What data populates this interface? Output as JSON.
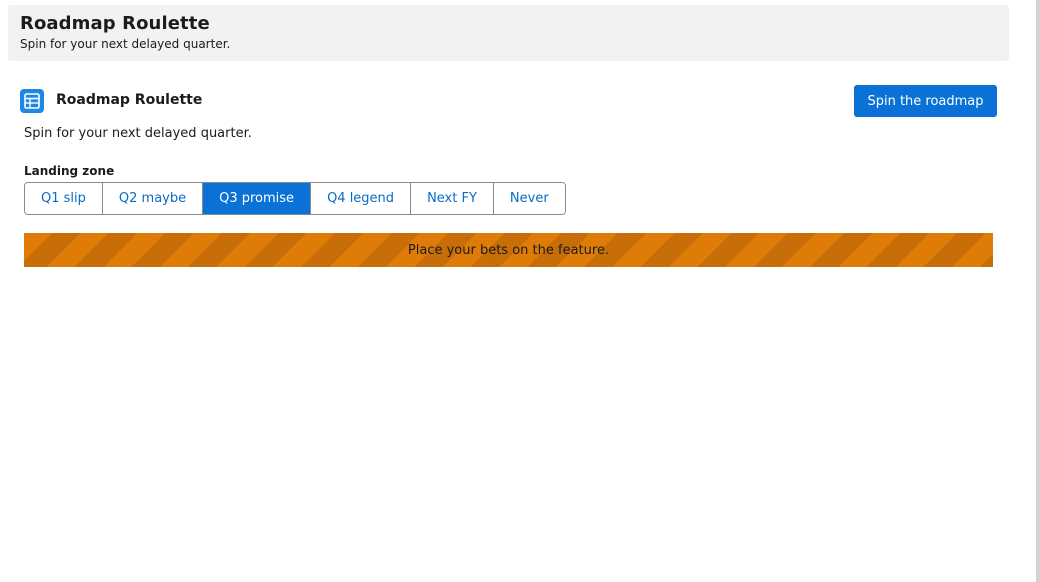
{
  "header": {
    "title": "Roadmap Roulette",
    "subtitle": "Spin for your next delayed quarter."
  },
  "card": {
    "icon": "table-icon",
    "title": "Roadmap Roulette",
    "description": "Spin for your next delayed quarter.",
    "spin_label": "Spin the roadmap"
  },
  "landing_zone": {
    "label": "Landing zone",
    "options": [
      "Q1 slip",
      "Q2 maybe",
      "Q3 promise",
      "Q4 legend",
      "Next FY",
      "Never"
    ],
    "selected": "Q3 promise"
  },
  "banner": {
    "text": "Place your bets on the feature.",
    "color": "#df7c08"
  },
  "colors": {
    "accent": "#0a72d6",
    "banner_stripe": "#c86e08"
  }
}
